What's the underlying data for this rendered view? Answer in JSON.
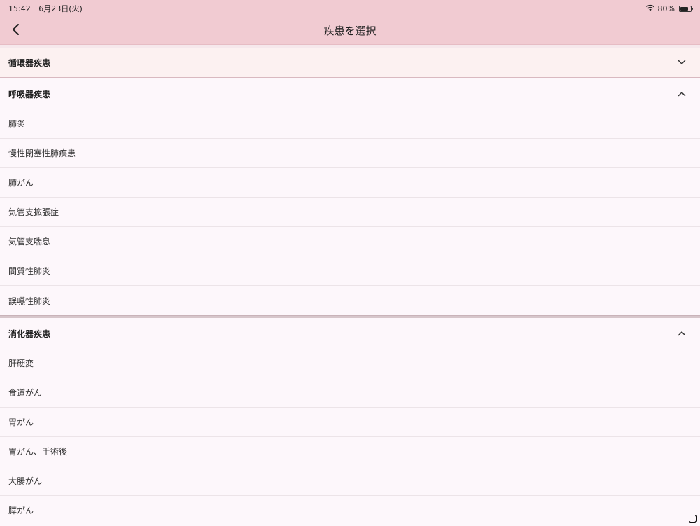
{
  "status": {
    "time": "15:42",
    "date": "6月23日(火)",
    "battery": "80%",
    "battery_level": 0.8
  },
  "nav": {
    "title": "疾患を選択"
  },
  "sections": [
    {
      "title": "循環器疾患",
      "expanded": false,
      "items": []
    },
    {
      "title": "呼吸器疾患",
      "expanded": true,
      "items": [
        "肺炎",
        "慢性閉塞性肺疾患",
        "肺がん",
        "気管支拡張症",
        "気管支喘息",
        "間質性肺炎",
        "誤嚥性肺炎"
      ]
    },
    {
      "title": "消化器疾患",
      "expanded": true,
      "items": [
        "肝硬変",
        "食道がん",
        "胃がん",
        "胃がん、手術後",
        "大腸がん",
        "膵がん"
      ]
    }
  ]
}
